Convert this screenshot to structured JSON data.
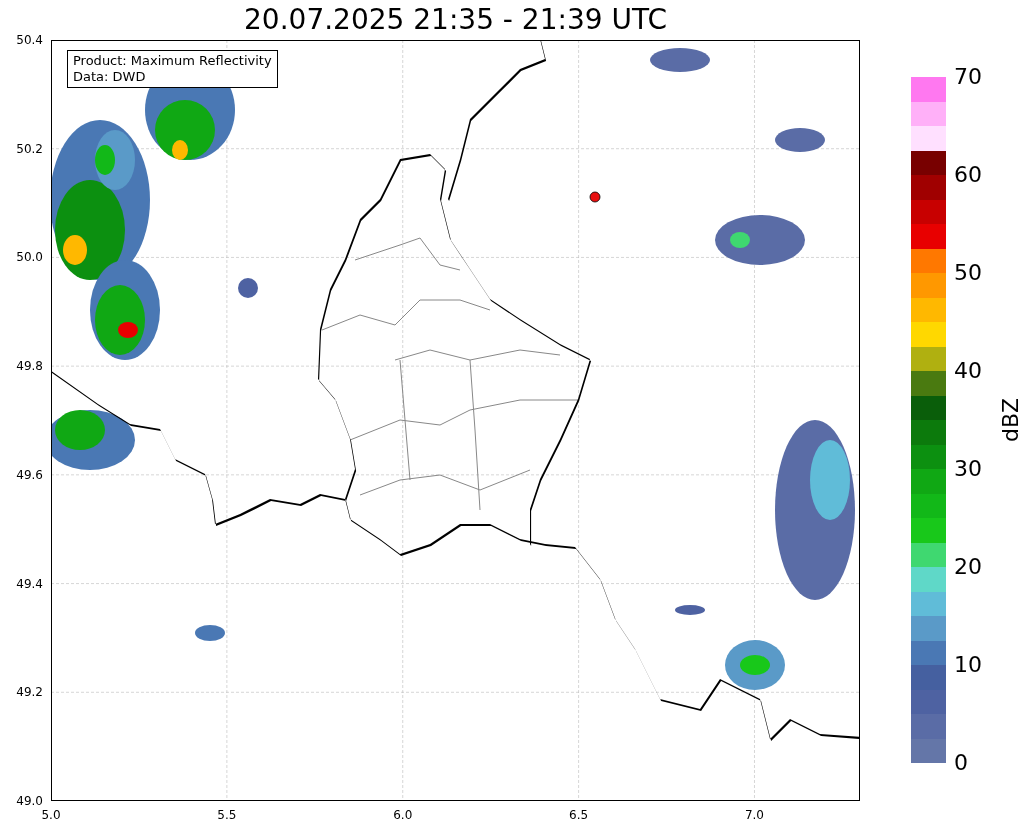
{
  "title": "20.07.2025 21:35 - 21:39 UTC",
  "legend": {
    "lines": [
      "Product: Maximum Reflectivity",
      "Data: DWD"
    ]
  },
  "x_axis": {
    "ticks": [
      "5.0",
      "5.5",
      "6.0",
      "6.5",
      "7.0"
    ]
  },
  "y_axis": {
    "ticks": [
      "50.4",
      "50.2",
      "50.0",
      "49.8",
      "49.6",
      "49.4",
      "49.2",
      "49.0"
    ]
  },
  "colorbar": {
    "label": "dBZ",
    "ticks": [
      "70",
      "60",
      "50",
      "40",
      "30",
      "20",
      "10",
      "0"
    ]
  }
}
